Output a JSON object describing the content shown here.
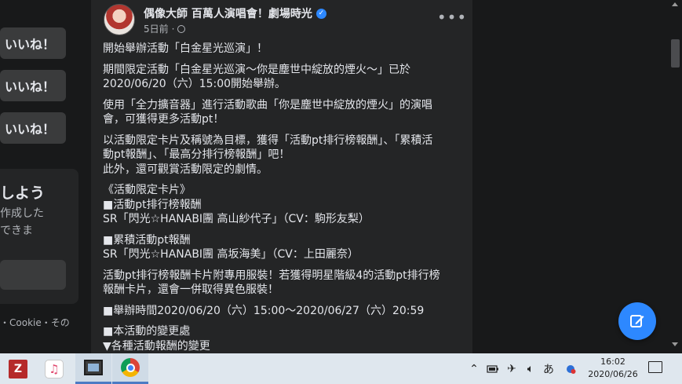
{
  "left": {
    "like_buttons": [
      "いいね！",
      "いいね！",
      "いいね！"
    ],
    "card": {
      "title": "しよう",
      "line1": "作成した",
      "line2": "できま"
    },
    "footer": "・Cookie・その"
  },
  "post": {
    "author": "偶像大師 百萬人演唱會！劇場時光",
    "time": "5日前",
    "paragraphs": [
      "開始舉辦活動「白金星光巡演」！",
      "期間限定活動「白金星光巡演～你是塵世中綻放的煙火～」已於\n2020/06/20（六）15:00開始舉辦。",
      "使用「全力擴音器」進行活動歌曲「你是塵世中綻放的煙火」的演唱\n會，可獲得更多活動pt！",
      "以活動限定卡片及稱號為目標，獲得「活動pt排行榜報酬」、「累積活\n動pt報酬」、「最高分排行榜報酬」吧！\n此外，還可觀賞活動限定的劇情。",
      "《活動限定卡片》\n■活動pt排行榜報酬\nSR「閃光☆HANABI團 高山紗代子」（CV：駒形友梨）",
      "■累積活動pt報酬\nSR「閃光☆HANABI團 高坂海美」（CV：上田麗奈）",
      "活動pt排行榜報酬卡片附專用服裝！若獲得明星階級4的活動pt排行榜\n報酬卡片，還會一併取得異色服裝！",
      "■舉辦時間2020/06/20（六）15:00～2020/06/27（六）20:59",
      "■本活動的變更處\n▼各種活動報酬的變更"
    ]
  },
  "taskbar": {
    "apps": [
      "filezilla-icon",
      "itunes-icon",
      "video-editor-icon",
      "chrome-icon"
    ],
    "ime": "あ",
    "time": "16:02",
    "date": "2020/06/26"
  }
}
